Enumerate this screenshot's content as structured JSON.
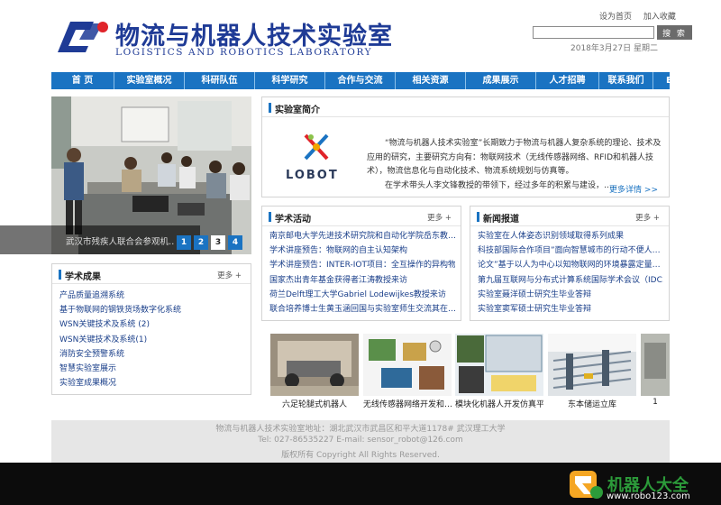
{
  "header": {
    "title_cn": "物流与机器人技术实验室",
    "title_en": "LOGISTICS AND ROBOTICS LABORATORY",
    "set_home": "设为首页",
    "add_favorite": "加入收藏",
    "search_button": "搜 索",
    "search_value": "",
    "date": "2018年3月27日  星期二"
  },
  "nav": {
    "items": [
      "首 页",
      "实验室概况",
      "科研队伍",
      "科学研究",
      "合作与交流",
      "相关资源",
      "成果展示",
      "人才招聘",
      "联系我们",
      "English Ver"
    ]
  },
  "slider": {
    "caption": "武汉市残疾人联合会参观机…",
    "pages": [
      "1",
      "2",
      "3",
      "4"
    ],
    "active_page": "3"
  },
  "achievements": {
    "title": "学术成果",
    "more": "更多 +",
    "items": [
      "产品质量追溯系统",
      "基于物联网的钢铁货场数字化系统",
      "WSN关键技术及系统 (2)",
      "WSN关键技术及系统(1)",
      "消防安全预警系统",
      "智慧实验室展示",
      "实验室成果概况"
    ]
  },
  "intro": {
    "title": "实验室简介",
    "logo_text": "LOBOT",
    "text": "“物流与机器人技术实验室”长期致力于物流与机器人复杂系统的理论、技术及应用的研究，主要研究方向有：物联网技术（无线传感器网络、RFID和机器人技术），物流信息化与自动化技术、物流系统规划与仿真等。",
    "text2": "在学术带头人李文锋教授的带领下，经过多年的积累与建设，……",
    "more": "更多详情 >>"
  },
  "academic": {
    "title": "学术活动",
    "more": "更多 +",
    "items": [
      "南京邮电大学先进技术研究院和自动化学院岳东教…",
      "学术讲座预告：物联网的自主认知架构",
      "学术讲座预告：INTER-IOT项目：全互操作的异构物…",
      "国家杰出青年基金获得者江涛教授来访",
      "荷兰Delft理工大学Gabriel Lodewijkes教授来访",
      "联合培养博士生黄玉涵回国与实验室师生交流其在…"
    ]
  },
  "news": {
    "title": "新闻报道",
    "more": "更多 +",
    "items": [
      "实验室在人体姿态识别领域取得系列成果",
      "科技部国际合作项目”面向智慧城市的行动不便人…",
      "论文”基于以人为中心以知物联网的环境暴露定量…",
      "第九届互联网与分布式计算系统国际学术会议（IDC…",
      "实验室聂洋硕士研究生毕业答辩",
      "实验室窦军硕士研究生毕业答辩"
    ]
  },
  "gallery": {
    "items": [
      "六足轮腿式机器人",
      "无线传感器网络开发和…",
      "模块化机器人开发仿真平",
      "东本储运立库",
      "1"
    ]
  },
  "footer": {
    "address": "物流与机器人技术实验室地址：湖北武汉市武昌区和平大道1178# 武汉理工大学",
    "contact": "Tel: 027-86535227  E-mail: sensor_robot@126.com",
    "copyright": "版权所有 Copyright All Rights Reserved."
  },
  "watermark": {
    "title": "机器人大全",
    "url": "www.robo123.com"
  },
  "colors": {
    "brand_blue": "#1f3b96",
    "nav_blue": "#1a73c2",
    "brand_red": "#e0242a",
    "watermark_green": "#2c9b3a"
  }
}
